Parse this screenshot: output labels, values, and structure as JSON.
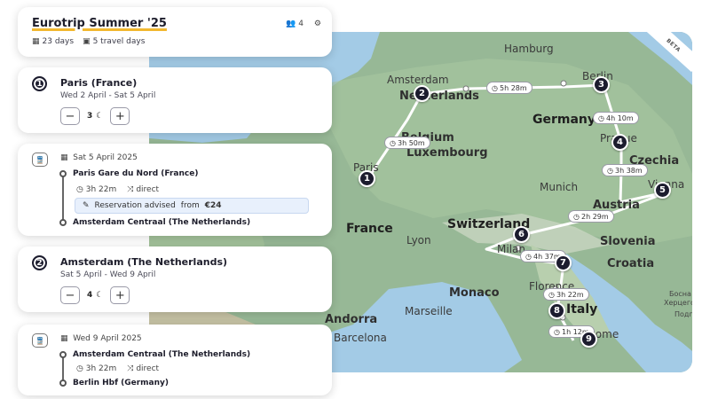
{
  "trip": {
    "title": "Eurotrip Summer '25",
    "days": "23 days",
    "travel_days": "5 travel days",
    "travellers": "4"
  },
  "destinations": [
    {
      "number": "1",
      "name": "Paris (France)",
      "dates": "Wed 2 April - Sat 5 April",
      "nights": "3"
    },
    {
      "number": "2",
      "name": "Amsterdam (The Netherlands)",
      "dates": "Sat 5 April - Wed 9 April",
      "nights": "4"
    }
  ],
  "trains": [
    {
      "date": "Sat 5 April 2025",
      "from": "Paris Gare du Nord  (France)",
      "duration": "3h 22m",
      "type": "direct",
      "advice": "Reservation advised",
      "price_label": "from",
      "price": "€24",
      "to": "Amsterdam Centraal (The Netherlands)"
    },
    {
      "date": "Wed 9 April 2025",
      "from": "Amsterdam Centraal (The Netherlands)",
      "duration": "3h 22m",
      "type": "direct",
      "to": "Berlin Hbf (Germany)"
    }
  ],
  "map": {
    "beta": "BETA",
    "labels": {
      "hamburg": "Hamburg",
      "amsterdam": "Amsterdam",
      "netherlands": "Netherlands",
      "berlin": "Berlin",
      "germany": "Germany",
      "belgium": "Belgium",
      "luxembourg": "Luxembourg",
      "prague": "Prague",
      "czechia": "Czechia",
      "paris": "Paris",
      "munich": "Munich",
      "vienna": "Vienna",
      "austria": "Austria",
      "france": "France",
      "switzerland": "Switzerland",
      "lyon": "Lyon",
      "milan": "Milan",
      "slovenia": "Slovenia",
      "croatia": "Croatia",
      "monaco": "Monaco",
      "marseille": "Marseille",
      "florence": "Florence",
      "italy": "Italy",
      "andorra": "Andorra",
      "barcelona": "Barcelona",
      "rome": "Rome",
      "bih1": "Босна и",
      "bih2": "Херцеговина",
      "pod": "Подг"
    },
    "legs": [
      "3h 50m",
      "5h 28m",
      "4h 10m",
      "3h 38m",
      "2h 29m",
      "4h 37m",
      "3h 22m",
      "1h 12m"
    ],
    "stops": [
      "1",
      "2",
      "3",
      "4",
      "5",
      "6",
      "7",
      "8",
      "9"
    ]
  },
  "icons": {
    "calendar": "calendar-icon",
    "suitcase": "suitcase-icon",
    "people": "people-icon",
    "settings": "settings-icon",
    "moon": "moon-icon",
    "train": "train-icon",
    "clock": "clock-icon",
    "shuffle": "direct-icon",
    "ticket": "ticket-icon"
  },
  "colors": {
    "accent_underline": "#f2b830",
    "stop": "#1c1c2e",
    "advice_bg": "#e8f0fc"
  }
}
